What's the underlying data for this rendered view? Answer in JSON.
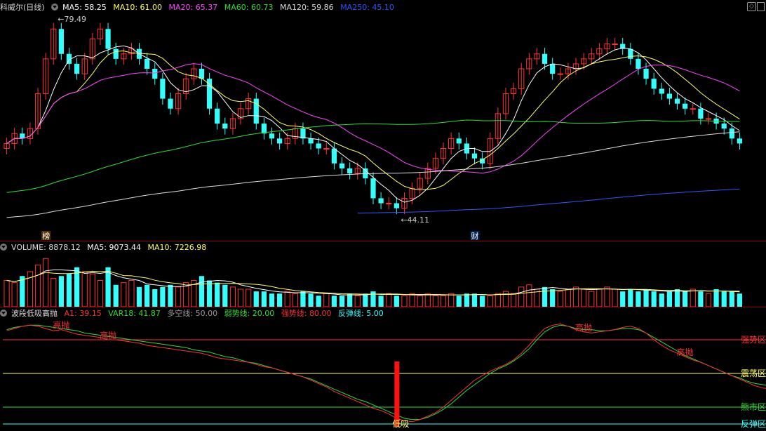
{
  "main_panel": {
    "title": "科威尔(日线)",
    "indicators": [
      {
        "label": "MA5: 58.25",
        "color": "#ffffff"
      },
      {
        "label": "MA10: 61.00",
        "color": "#ffff66"
      },
      {
        "label": "MA20: 65.37",
        "color": "#ff44ff"
      },
      {
        "label": "MA60: 60.73",
        "color": "#33dd33"
      },
      {
        "label": "MA120: 59.86",
        "color": "#dddddd"
      },
      {
        "label": "MA250: 45.10",
        "color": "#3355ff"
      }
    ],
    "high_label": "79.49",
    "low_label": "44.11",
    "event_markers": [
      {
        "text": "榜"
      },
      {
        "text": "财"
      }
    ]
  },
  "volume_panel": {
    "title": "VOLUME: 8878.12",
    "indicators": [
      {
        "label": "MA5: 9073.44",
        "color": "#ffffff"
      },
      {
        "label": "MA10: 7226.98",
        "color": "#ffff66"
      }
    ]
  },
  "osc_panel": {
    "title": "波段低吸高抛",
    "indicators": [
      {
        "label": "A1: 39.15",
        "color": "#ff3333"
      },
      {
        "label": "VAR18: 41.87",
        "color": "#33dd33"
      },
      {
        "label": "多空线: 50.00",
        "color": "#999999"
      },
      {
        "label": "弱势线: 20.00",
        "color": "#33dd33"
      },
      {
        "label": "强势线: 80.00",
        "color": "#ff3333"
      },
      {
        "label": "反弹线: 5.00",
        "color": "#33ffff"
      }
    ],
    "zones": [
      {
        "text": "强势区",
        "value": 80,
        "color": "#ff3333"
      },
      {
        "text": "震荡区",
        "value": 50,
        "color": "#ffff66"
      },
      {
        "text": "熊市区",
        "value": 20,
        "color": "#33dd33"
      },
      {
        "text": "反弹区",
        "value": 5,
        "color": "#33ffff"
      }
    ],
    "signals": [
      {
        "text": "高抛",
        "i": 7
      },
      {
        "text": "高抛",
        "i": 13
      },
      {
        "text": "高抛",
        "i": 74
      },
      {
        "text": "高抛",
        "i": 87
      },
      {
        "text": "低吸",
        "i": 50
      }
    ]
  },
  "chart_data": {
    "type": "candlestick",
    "count": 100,
    "price_range": [
      40,
      83
    ],
    "closes": [
      57,
      59,
      58,
      60,
      67,
      74,
      80,
      75,
      73,
      71,
      74,
      78,
      80,
      76,
      74,
      75,
      76,
      74,
      72,
      70,
      66,
      64,
      67,
      70,
      72,
      70,
      64,
      61,
      60,
      62,
      64,
      66,
      61,
      59,
      58,
      57,
      58,
      60,
      58,
      57,
      56,
      56,
      53,
      52,
      51,
      52,
      50,
      46,
      45,
      45,
      44,
      46,
      48,
      50,
      52,
      54,
      56,
      58,
      57,
      55,
      54,
      53,
      58,
      63,
      67,
      68,
      72,
      74,
      75,
      73,
      71,
      71,
      72,
      73,
      74,
      75,
      76,
      77,
      77,
      76,
      74,
      72,
      70,
      68,
      67,
      66,
      65,
      64,
      64,
      62,
      62,
      61,
      60,
      58,
      57
    ],
    "ma_periods": [
      5,
      10,
      20,
      60,
      120,
      250
    ],
    "volume_range": [
      0,
      24000
    ],
    "volumes": [
      12,
      11,
      14,
      16,
      19,
      22,
      13,
      14,
      15,
      18,
      16,
      15,
      12,
      18,
      10,
      11,
      12,
      9,
      10,
      8,
      9,
      10,
      9,
      11,
      12,
      14,
      12,
      11,
      10,
      9,
      8,
      8,
      7,
      7,
      6,
      6,
      7,
      6,
      7,
      6,
      5,
      6,
      5,
      5,
      6,
      5,
      6,
      7,
      5,
      6,
      5,
      5,
      6,
      5,
      6,
      5,
      5,
      6,
      5,
      6,
      6,
      5,
      5,
      6,
      7,
      6,
      9,
      10,
      8,
      9,
      8,
      7,
      8,
      9,
      8,
      7,
      8,
      9,
      8,
      7,
      8,
      7,
      8,
      7,
      6,
      7,
      8,
      7,
      8,
      7,
      6,
      8,
      7,
      7,
      6,
      6,
      7,
      8,
      9,
      7
    ],
    "osc_range": [
      0,
      100
    ],
    "a1": [
      88,
      90,
      92,
      93,
      92,
      90,
      88,
      89,
      87,
      85,
      84,
      83,
      82,
      80,
      80,
      79,
      78,
      77,
      75,
      74,
      73,
      72,
      71,
      70,
      69,
      68,
      66,
      64,
      63,
      62,
      61,
      60,
      58,
      56,
      55,
      53,
      51,
      49,
      47,
      44,
      41,
      38,
      34,
      31,
      28,
      25,
      22,
      19,
      17,
      14,
      10,
      8,
      7,
      9,
      12,
      15,
      20,
      26,
      32,
      38,
      44,
      48,
      52,
      55,
      58,
      62,
      68,
      75,
      83,
      90,
      93,
      94,
      92,
      89,
      87,
      86,
      87,
      88,
      89,
      91,
      92,
      90,
      86,
      80,
      75,
      71,
      68,
      65,
      62,
      60,
      57,
      54,
      51,
      48,
      45,
      42,
      39,
      37,
      36,
      35
    ],
    "var18": [
      89,
      91,
      92,
      93,
      93,
      92,
      91,
      90,
      89,
      88,
      86,
      85,
      84,
      83,
      82,
      81,
      80,
      79,
      78,
      77,
      76,
      75,
      74,
      73,
      71,
      70,
      69,
      67,
      65,
      64,
      62,
      60,
      59,
      57,
      55,
      53,
      51,
      49,
      47,
      45,
      42,
      39,
      36,
      33,
      30,
      27,
      25,
      22,
      19,
      16,
      13,
      10,
      9,
      9,
      11,
      14,
      18,
      23,
      29,
      35,
      40,
      45,
      50,
      54,
      57,
      61,
      66,
      72,
      80,
      87,
      91,
      93,
      92,
      90,
      89,
      89,
      88,
      88,
      89,
      90,
      90,
      89,
      86,
      82,
      78,
      74,
      70,
      66,
      63,
      60,
      57,
      54,
      51,
      48,
      46,
      43,
      41,
      40,
      39,
      38
    ]
  }
}
